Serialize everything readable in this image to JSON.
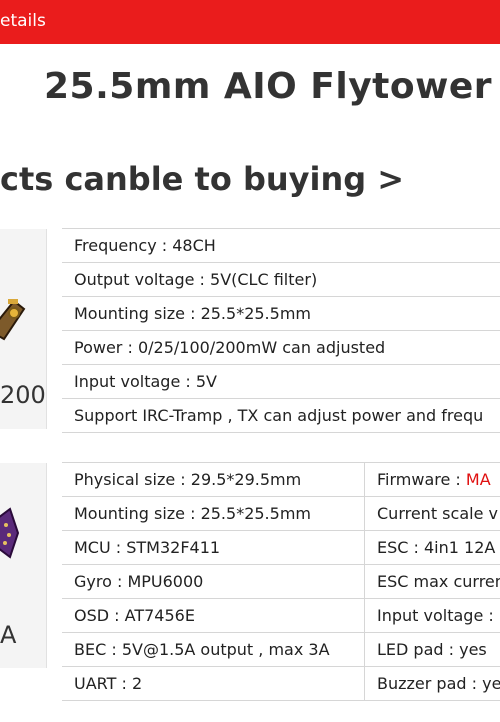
{
  "header": {
    "tab_label": "etails"
  },
  "title": "25.5mm AIO Flytower",
  "subtitle": "cts canble to buying >",
  "section1": {
    "product_label": "200",
    "specs": [
      "Frequency : 48CH",
      "Output voltage : 5V(CLC filter)",
      "Mounting size : 25.5*25.5mm",
      "Power : 0/25/100/200mW can adjusted",
      "Input voltage : 5V",
      "Support IRC-Tramp , TX can adjust power and frequ"
    ]
  },
  "section2": {
    "product_label": "A",
    "rows": [
      {
        "left": "Physical size : 29.5*29.5mm",
        "right_prefix": "Firmware : ",
        "right_value": "MA"
      },
      {
        "left": "Mounting size : 25.5*25.5mm",
        "right_prefix": "Current scale v",
        "right_value": ""
      },
      {
        "left": "MCU : STM32F411",
        "right_prefix": "ESC : 4in1 12A",
        "right_value": ""
      },
      {
        "left": "Gyro : MPU6000",
        "right_prefix": "ESC max curren",
        "right_value": ""
      },
      {
        "left": "OSD : AT7456E",
        "right_prefix": "Input voltage :",
        "right_value": ""
      },
      {
        "left": "BEC : 5V@1.5A output , max 3A",
        "right_prefix": "LED pad : yes",
        "right_value": ""
      },
      {
        "left": "UART : 2",
        "right_prefix": "Buzzer pad : ye",
        "right_value": ""
      }
    ]
  },
  "colors": {
    "accent": "#ea1c1c",
    "text": "#222222",
    "border": "#d6d6d6",
    "panel": "#f4f4f4"
  }
}
